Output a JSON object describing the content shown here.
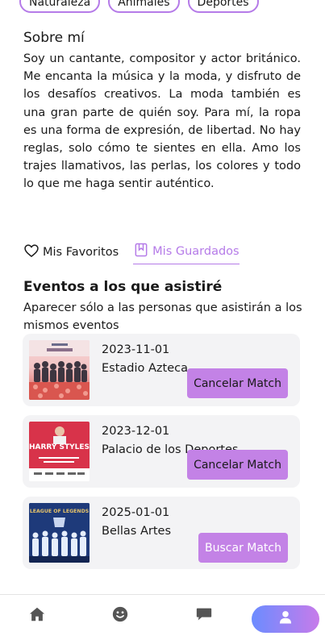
{
  "interests": [
    "Naturaleza",
    "Animales",
    "Deportes"
  ],
  "about": {
    "title": "Sobre mí",
    "text": "Soy un cantante, compositor y actor británico. Me encanta la música y la moda, y disfruto de los desafíos creativos. La moda también es una gran parte de quién soy. Para mí, la ropa es una forma de expresión, de libertad. No hay reglas, solo cómo te sientes en ella. Amo los trajes llamativos, las perlas, los colores y todo lo que me haga sentir auténtico."
  },
  "tabs": {
    "favorites": "Mis Favoritos",
    "saved": "Mis Guardados"
  },
  "events": {
    "title": "Eventos a los que asistiré",
    "subtitle": "Aparecer sólo a las personas que asistirán a los mismos eventos",
    "items": [
      {
        "date": "2023-11-01",
        "venue": "Estadio Azteca",
        "action": "Cancelar Match"
      },
      {
        "date": "2023-12-01",
        "venue": "Palacio de los Deportes",
        "action": "Cancelar Match"
      },
      {
        "date": "2025-01-01",
        "venue": "Bellas Artes",
        "action": "Buscar Match"
      }
    ]
  },
  "poster_text": {
    "harry_styles": "HARRY STYLES",
    "league": "LEAGUE OF LEGENDS"
  },
  "nav": {
    "items": [
      "home-icon",
      "smiley-icon",
      "chat-icon",
      "user-icon"
    ]
  },
  "colors": {
    "accent": "#b57be8",
    "button": "#c382e6",
    "card_bg": "#f3f3f5",
    "pill_start": "#6b8cff",
    "pill_end": "#c77bea",
    "nav_icon": "#555555"
  }
}
